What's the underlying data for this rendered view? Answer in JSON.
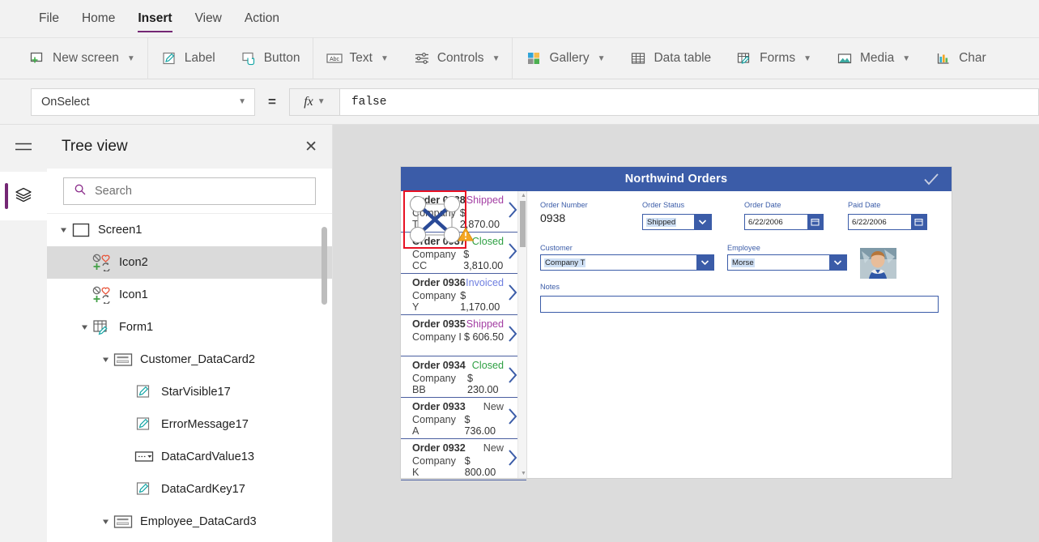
{
  "menubar": {
    "items": [
      {
        "label": "File",
        "active": false
      },
      {
        "label": "Home",
        "active": false
      },
      {
        "label": "Insert",
        "active": true
      },
      {
        "label": "View",
        "active": false
      },
      {
        "label": "Action",
        "active": false
      }
    ]
  },
  "ribbon": {
    "items": [
      {
        "label": "New screen",
        "icon": "new-screen-icon",
        "dropdown": true
      },
      {
        "label": "Label",
        "icon": "label-icon",
        "dropdown": false
      },
      {
        "label": "Button",
        "icon": "button-icon",
        "dropdown": false
      },
      {
        "label": "Text",
        "icon": "text-abc-icon",
        "dropdown": true
      },
      {
        "label": "Controls",
        "icon": "controls-sliders-icon",
        "dropdown": true
      },
      {
        "label": "Gallery",
        "icon": "gallery-icon",
        "dropdown": true
      },
      {
        "label": "Data table",
        "icon": "data-table-icon",
        "dropdown": false
      },
      {
        "label": "Forms",
        "icon": "forms-icon",
        "dropdown": true
      },
      {
        "label": "Media",
        "icon": "media-icon",
        "dropdown": true
      },
      {
        "label": "Char",
        "icon": "chart-icon",
        "dropdown": false
      }
    ]
  },
  "formula_bar": {
    "property": "OnSelect",
    "equals": "=",
    "fx": "fx",
    "value": "false"
  },
  "rail": {
    "hamburger_icon": "hamburger-menu-icon",
    "treeview_icon": "layers-tree-view-icon"
  },
  "tree_panel": {
    "title": "Tree view",
    "close_icon": "close-icon",
    "search_placeholder": "Search",
    "search_icon": "search-icon",
    "nodes": [
      {
        "label": "Screen1",
        "depth": 0,
        "icon": "screen-icon",
        "caret": true,
        "selected": false
      },
      {
        "label": "Icon2",
        "depth": 1,
        "icon": "icon-control-icon",
        "caret": false,
        "selected": true
      },
      {
        "label": "Icon1",
        "depth": 1,
        "icon": "icon-control-icon",
        "caret": false,
        "selected": false
      },
      {
        "label": "Form1",
        "depth": 1,
        "icon": "form-icon",
        "caret": true,
        "selected": false
      },
      {
        "label": "Customer_DataCard2",
        "depth": 2,
        "icon": "datacard-icon",
        "caret": true,
        "selected": false
      },
      {
        "label": "StarVisible17",
        "depth": 3,
        "icon": "label-control-icon",
        "caret": false,
        "selected": false
      },
      {
        "label": "ErrorMessage17",
        "depth": 3,
        "icon": "label-control-icon",
        "caret": false,
        "selected": false
      },
      {
        "label": "DataCardValue13",
        "depth": 3,
        "icon": "dropdown-control-icon",
        "caret": false,
        "selected": false
      },
      {
        "label": "DataCardKey17",
        "depth": 3,
        "icon": "label-control-icon",
        "caret": false,
        "selected": false
      },
      {
        "label": "Employee_DataCard3",
        "depth": 2,
        "icon": "datacard-icon",
        "caret": true,
        "selected": false
      }
    ]
  },
  "app": {
    "header_title": "Northwind Orders",
    "header_check_icon": "checkmark-icon",
    "selection": {
      "warning_icon": "warning-triangle-icon",
      "dragged_icon": "cancel-x-icon",
      "handle_count": 4,
      "border_color": "#e81123"
    },
    "gallery": {
      "items": [
        {
          "order": "Order 0938",
          "company": "Company T",
          "status": "Shipped",
          "status_color": "#a33ea3",
          "amount": "$ 2,870.00"
        },
        {
          "order": "Order 0937",
          "company": "Company CC",
          "status": "Closed",
          "status_color": "#2ea043",
          "amount": "$ 3,810.00"
        },
        {
          "order": "Order 0936",
          "company": "Company Y",
          "status": "Invoiced",
          "status_color": "#6f7fe0",
          "amount": "$ 1,170.00"
        },
        {
          "order": "Order 0935",
          "company": "Company I",
          "status": "Shipped",
          "status_color": "#a33ea3",
          "amount": "$ 606.50"
        },
        {
          "order": "Order 0934",
          "company": "Company BB",
          "status": "Closed",
          "status_color": "#2ea043",
          "amount": "$ 230.00"
        },
        {
          "order": "Order 0933",
          "company": "Company A",
          "status": "New",
          "status_color": "#4a4a4a",
          "amount": "$ 736.00"
        },
        {
          "order": "Order 0932",
          "company": "Company K",
          "status": "New",
          "status_color": "#4a4a4a",
          "amount": "$ 800.00"
        }
      ],
      "chevron_icon": "chevron-right-icon"
    },
    "form": {
      "order_number": {
        "label": "Order Number",
        "value": "0938"
      },
      "order_status": {
        "label": "Order Status",
        "value": "Shipped",
        "icon": "chevron-down-icon"
      },
      "order_date": {
        "label": "Order Date",
        "value": "6/22/2006",
        "icon": "calendar-icon"
      },
      "paid_date": {
        "label": "Paid Date",
        "value": "6/22/2006",
        "icon": "calendar-icon"
      },
      "customer": {
        "label": "Customer",
        "value": "Company T",
        "icon": "chevron-down-icon"
      },
      "employee": {
        "label": "Employee",
        "value": "Morse",
        "icon": "chevron-down-icon"
      },
      "employee_photo_alt": "employee-photo",
      "notes": {
        "label": "Notes",
        "value": ""
      }
    }
  },
  "colors": {
    "accent_purple": "#742774",
    "app_blue": "#3b5ca8",
    "selection_red": "#e81123",
    "warning_amber": "#f2a200"
  }
}
